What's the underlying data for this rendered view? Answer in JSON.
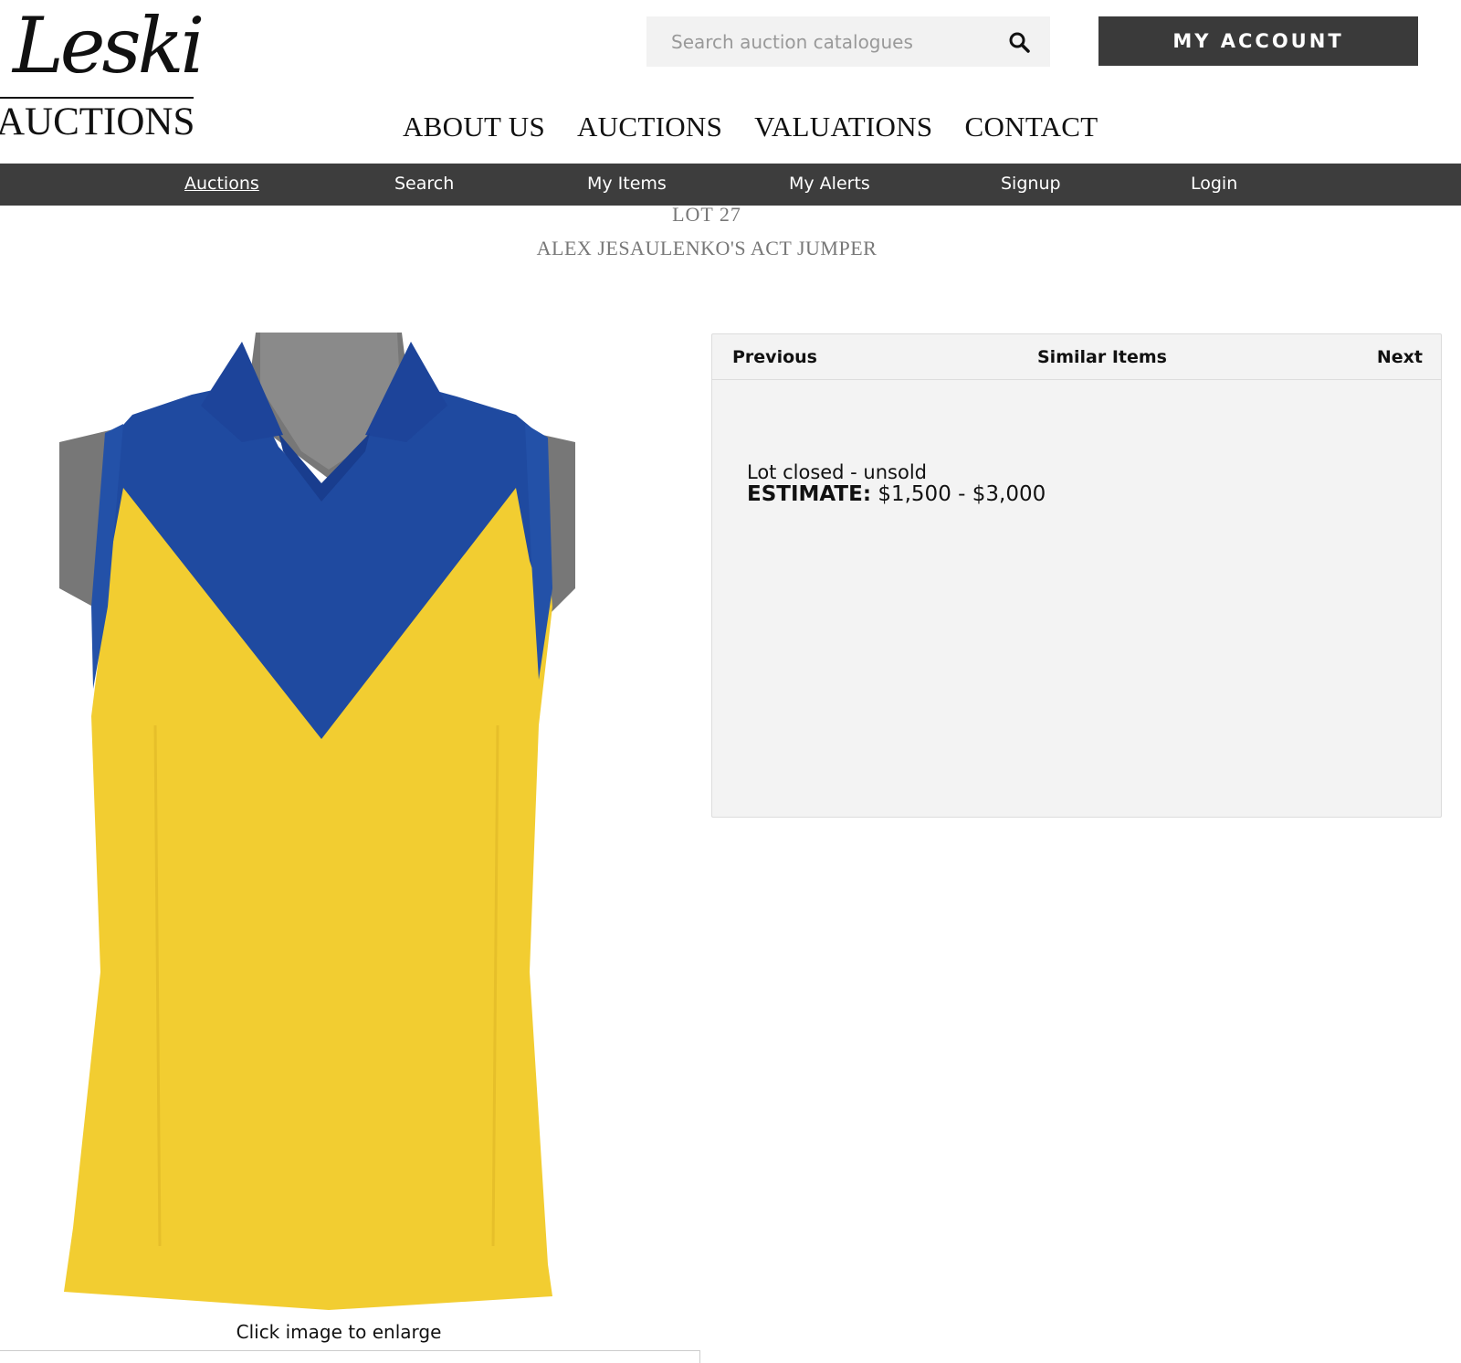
{
  "logo": {
    "script": "Leski",
    "word": "AUCTIONS"
  },
  "search": {
    "placeholder": "Search auction catalogues"
  },
  "account": {
    "label": "MY ACCOUNT"
  },
  "main_nav": [
    "ABOUT US",
    "AUCTIONS",
    "VALUATIONS",
    "CONTACT"
  ],
  "sub_nav": [
    "Auctions",
    "Search",
    "My Items",
    "My Alerts",
    "Signup",
    "Login"
  ],
  "lot": {
    "number": "LOT 27",
    "title": "ALEX JESAULENKO'S ACT JUMPER",
    "image_caption": "Click image to enlarge"
  },
  "panel": {
    "previous": "Previous",
    "similar": "Similar Items",
    "next": "Next",
    "status": "Lot closed - unsold",
    "estimate_label": "ESTIMATE:",
    "estimate_value": "$1,500 - $3,000"
  },
  "colors": {
    "dark_bar": "#3d3d3d",
    "jumper_yellow": "#f2cd31",
    "jumper_blue": "#1f4aa0"
  },
  "icons": [
    "search-icon"
  ]
}
